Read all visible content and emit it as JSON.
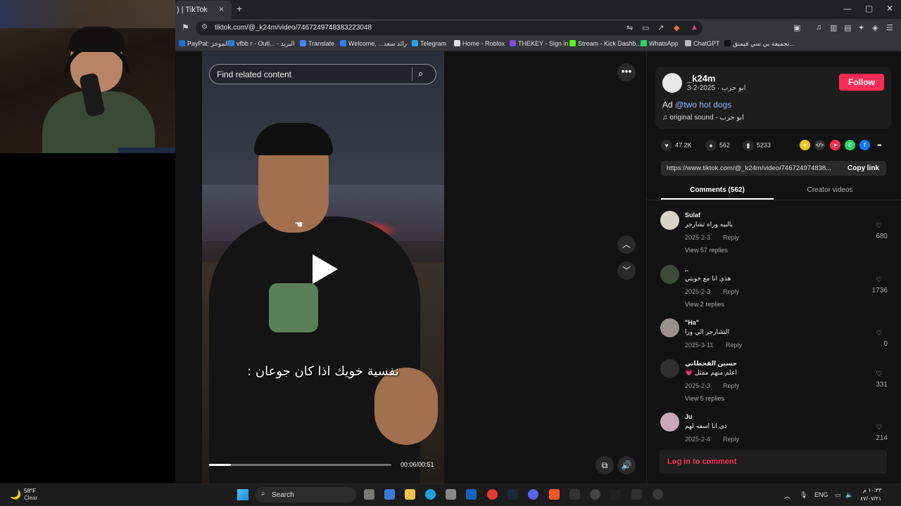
{
  "browser": {
    "tab_title": ") | TikTok",
    "tab_close": "×",
    "new_tab": "+",
    "url": "tiktok.com/@_k24m/video/7467249748383223048",
    "window": {
      "minimize": "—",
      "maximize": "▢",
      "close": "✕"
    },
    "bookmarks": [
      {
        "label": "PayPal: الموجز",
        "color": "#1e6fd9"
      },
      {
        "label": "vfbb r - Outl... - البريد",
        "color": "#2a7bd5"
      },
      {
        "label": "Translate",
        "color": "#4285f4"
      },
      {
        "label": "Welcome, ...رائد سعد",
        "color": "#2d7ff9"
      },
      {
        "label": "Telegram",
        "color": "#2aa3e0"
      },
      {
        "label": "Home - Roblox",
        "color": "#e0e0e0"
      },
      {
        "label": "THEKEY - Sign in",
        "color": "#7d4cdb"
      },
      {
        "label": "Stream - Kick Dashb...",
        "color": "#53fc18"
      },
      {
        "label": "WhatsApp",
        "color": "#25d366"
      },
      {
        "label": "ChatGPT",
        "color": "#bbbbbb"
      },
      {
        "label": "تجميعة بي سي فيمنق...",
        "color": "#111111"
      }
    ]
  },
  "video": {
    "search_placeholder": "Find related content",
    "caption": "نفسية خويك اذا كان جوعان :",
    "time": "00:06/00:51",
    "progress": 0.12,
    "more": "•••"
  },
  "author": {
    "username": "_k24m",
    "display_name_date": "ابو حرب · 2025-2-3",
    "follow_label": "Follow",
    "desc_prefix": "Ad",
    "desc_tag": "@two hot dogs",
    "sound": "original sound - ابو حرب"
  },
  "stats": {
    "likes": "47.2K",
    "comments": "562",
    "saves": "5233"
  },
  "share": {
    "link": "https://www.tiktok.com/@_k24m/video/746724974838...",
    "copy_label": "Copy link"
  },
  "tabs": {
    "comments": "Comments (562)",
    "creator": "Creator videos"
  },
  "comments": [
    {
      "name": "Sulaf",
      "text": "يالبيه وراه تشارجر",
      "date": "2025-2-3",
      "reply": "Reply",
      "replies": "View 57 replies",
      "likes": "680",
      "avatar": "#d9d4c8"
    },
    {
      "name": "..",
      "text": "هذي انا مع خويتي",
      "date": "2025-2-3",
      "reply": "Reply",
      "replies": "View 2 replies",
      "likes": "1736",
      "avatar": "#3d4a3a"
    },
    {
      "name": "\"Ha\"",
      "text": "التشارجر الي ورا",
      "date": "2025-3-11",
      "reply": "Reply",
      "replies": "",
      "likes": "0",
      "avatar": "#9a8f8a"
    },
    {
      "name": "حسين القحطاني",
      "text": "اعلم متهم ممثل 💗",
      "date": "2025-2-3",
      "reply": "Reply",
      "replies": "View 5 replies",
      "likes": "331",
      "avatar": "#2f2f2f"
    },
    {
      "name": "Ju",
      "text": "ذي انا اسفه لهم",
      "date": "2025-2-4",
      "reply": "Reply",
      "replies": "",
      "likes": "214",
      "avatar": "#c9a8b8"
    }
  ],
  "login_label": "Log in to comment",
  "taskbar": {
    "temp": "58°F",
    "weather": "Clear",
    "search": "Search",
    "lang": "ENG",
    "time": "١٠:٣٣ م",
    "date": "٤٧/٠٧/٢١"
  }
}
